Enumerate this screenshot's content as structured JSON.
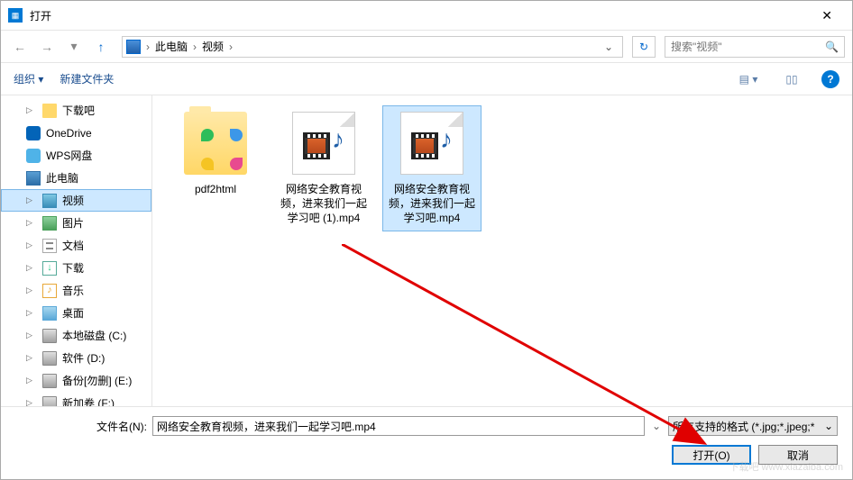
{
  "window": {
    "title": "打开"
  },
  "nav": {
    "breadcrumb": {
      "root": "此电脑",
      "current": "视频"
    },
    "search_placeholder": "搜索\"视频\""
  },
  "toolbar": {
    "organize": "组织 ▾",
    "new_folder": "新建文件夹"
  },
  "sidebar": {
    "items": [
      {
        "label": "下载吧",
        "ico": "ico-folder",
        "indent": true
      },
      {
        "label": "OneDrive",
        "ico": "ico-onedrive",
        "indent": false
      },
      {
        "label": "WPS网盘",
        "ico": "ico-wps",
        "indent": false
      },
      {
        "label": "此电脑",
        "ico": "ico-pc",
        "indent": false
      },
      {
        "label": "视频",
        "ico": "ico-video",
        "indent": true,
        "selected": true
      },
      {
        "label": "图片",
        "ico": "ico-pic",
        "indent": true
      },
      {
        "label": "文档",
        "ico": "ico-doc",
        "indent": true
      },
      {
        "label": "下载",
        "ico": "ico-dl",
        "indent": true
      },
      {
        "label": "音乐",
        "ico": "ico-music",
        "indent": true
      },
      {
        "label": "桌面",
        "ico": "ico-desk",
        "indent": true
      },
      {
        "label": "本地磁盘 (C:)",
        "ico": "ico-disk",
        "indent": true
      },
      {
        "label": "软件 (D:)",
        "ico": "ico-disk",
        "indent": true
      },
      {
        "label": "备份[勿删] (E:)",
        "ico": "ico-disk",
        "indent": true
      },
      {
        "label": "新加卷 (F:)",
        "ico": "ico-disk",
        "indent": true
      }
    ]
  },
  "files": [
    {
      "name": "pdf2html",
      "type": "folder"
    },
    {
      "name": "网络安全教育视频，进来我们一起学习吧 (1).mp4",
      "type": "video"
    },
    {
      "name": "网络安全教育视频，进来我们一起学习吧.mp4",
      "type": "video",
      "selected": true
    }
  ],
  "footer": {
    "filename_label": "文件名(N):",
    "filename_value": "网络安全教育视频，进来我们一起学习吧.mp4",
    "filetype_label": "所有支持的格式 (*.jpg;*.jpeg;*",
    "open_btn": "打开(O)",
    "cancel_btn": "取消"
  },
  "watermark": "下载吧 www.xiazaiba.com"
}
